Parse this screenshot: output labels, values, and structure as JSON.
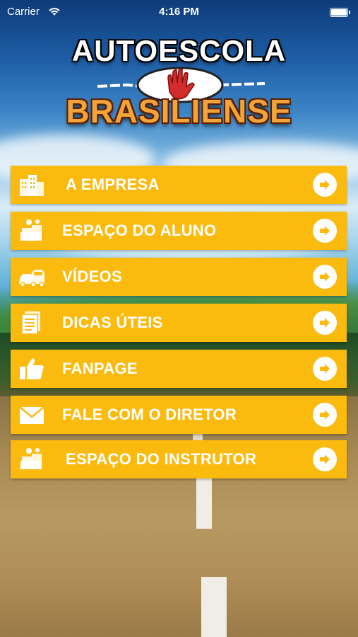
{
  "status_bar": {
    "carrier": "Carrier",
    "time": "4:16 PM"
  },
  "logo": {
    "top_text": "AUTOESCOLA",
    "bottom_text": "BRASILIENSE"
  },
  "menu": {
    "items": [
      {
        "label": "A EMPRESA",
        "icon": "building-icon"
      },
      {
        "label": "ESPAÇO DO ALUNO",
        "icon": "student-icon"
      },
      {
        "label": "VÍDEOS",
        "icon": "car-icon"
      },
      {
        "label": "DICAS ÚTEIS",
        "icon": "document-icon"
      },
      {
        "label": "FANPAGE",
        "icon": "thumbs-up-icon"
      },
      {
        "label": "FALE COM O DIRETOR",
        "icon": "envelope-icon"
      },
      {
        "label": "ESPAÇO DO INSTRUTOR",
        "icon": "instructor-icon"
      }
    ]
  },
  "colors": {
    "button": "#fbbb0e",
    "arrow_icon": "#fbbb0e",
    "text": "#ffffff"
  }
}
